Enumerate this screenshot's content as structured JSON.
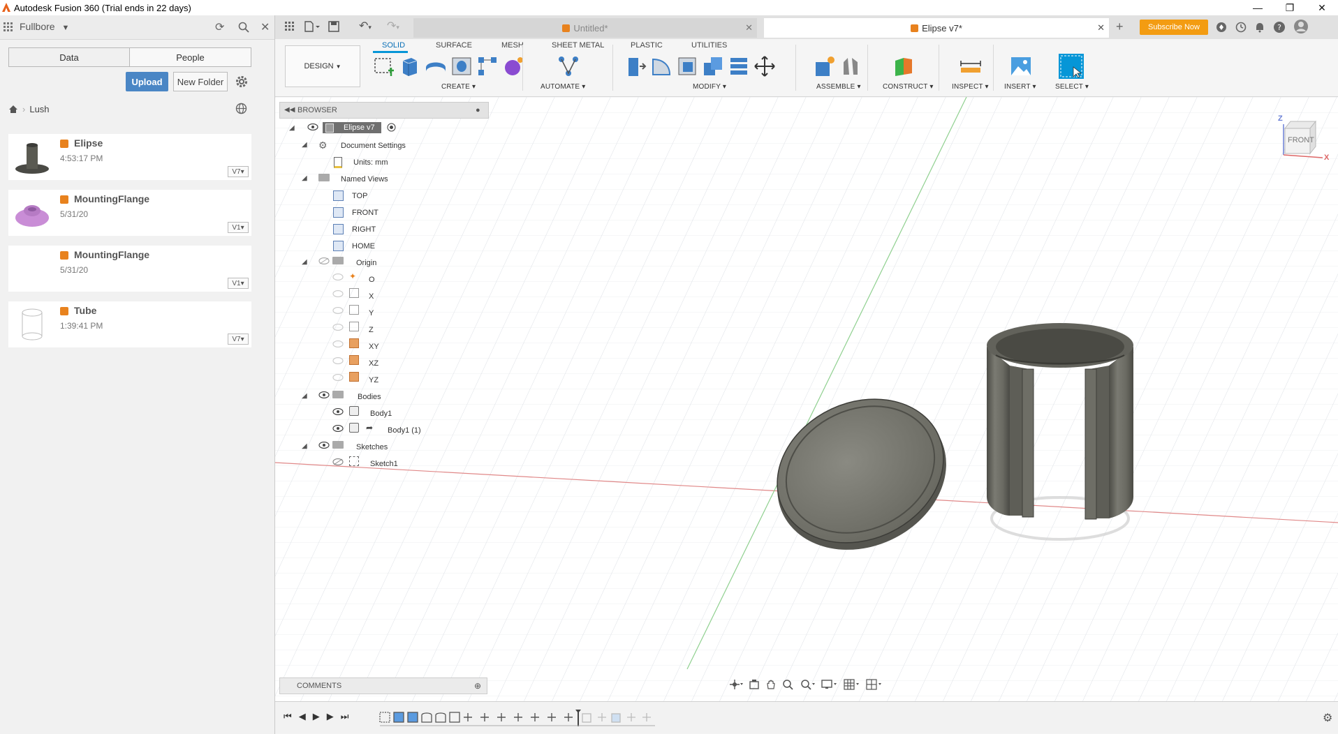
{
  "window": {
    "title": "Autodesk Fusion 360 (Trial ends in 22 days)",
    "controls": [
      "—",
      "❐",
      "✕"
    ]
  },
  "data_panel": {
    "team": "Fullbore",
    "tabs": [
      "Data",
      "People"
    ],
    "upload_label": "Upload",
    "new_folder_label": "New Folder",
    "breadcrumb": "Lush",
    "files": [
      {
        "name": "Elipse",
        "date": "4:53:17 PM",
        "version": "V7"
      },
      {
        "name": "MountingFlange",
        "date": "5/31/20",
        "version": "V1"
      },
      {
        "name": "MountingFlange",
        "date": "5/31/20",
        "version": "V1"
      },
      {
        "name": "Tube",
        "date": "1:39:41 PM",
        "version": "V7"
      }
    ]
  },
  "doc_tabs": [
    {
      "label": "Untitled*",
      "active": false
    },
    {
      "label": "Elipse v7*",
      "active": true
    }
  ],
  "header_right": {
    "subscribe_label": "Subscribe Now"
  },
  "toolbar": {
    "workspace": "DESIGN",
    "tabs": [
      "SOLID",
      "SURFACE",
      "MESH",
      "SHEET METAL",
      "PLASTIC",
      "UTILITIES"
    ],
    "active_tab": "SOLID",
    "groups": [
      "CREATE",
      "AUTOMATE",
      "MODIFY",
      "ASSEMBLE",
      "CONSTRUCT",
      "INSPECT",
      "INSERT",
      "SELECT"
    ]
  },
  "browser": {
    "title": "BROWSER",
    "root": "Elipse v7",
    "items": {
      "doc_settings": "Document Settings",
      "units": "Units: mm",
      "named_views": "Named Views",
      "top": "TOP",
      "front": "FRONT",
      "right": "RIGHT",
      "home": "HOME",
      "origin": "Origin",
      "o": "O",
      "x": "X",
      "y": "Y",
      "z": "Z",
      "xy": "XY",
      "xz": "XZ",
      "yz": "YZ",
      "bodies": "Bodies",
      "body1": "Body1",
      "body1_1": "Body1 (1)",
      "sketches": "Sketches",
      "sketch1": "Sketch1"
    }
  },
  "viewcube": {
    "face": "FRONT",
    "axis_z": "Z",
    "axis_x": "X"
  },
  "comments": {
    "title": "COMMENTS"
  },
  "colors": {
    "accent_orange": "#e8821e",
    "select_blue": "#0696d7",
    "upload_blue": "#4a86c5"
  }
}
